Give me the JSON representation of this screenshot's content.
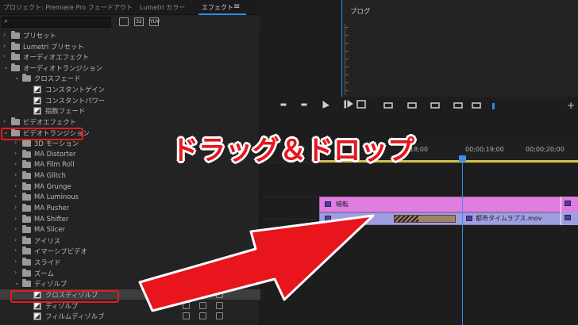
{
  "tabs": {
    "project": "プロジェクト: Premiere Pro フェードアウト",
    "lumetri": "Lumetri カラー",
    "effects": "エフェクト",
    "menu_icon": "hamburger-icon"
  },
  "search": {
    "placeholder": "",
    "icon": "search-icon"
  },
  "filter_buttons": [
    "accelerated-effects-icon",
    "32bit-icon",
    "yuv-icon"
  ],
  "tree": [
    {
      "label": "プリセット",
      "indent": 0,
      "expanded": false,
      "type": "folder-star"
    },
    {
      "label": "Lumetri プリセット",
      "indent": 0,
      "expanded": false,
      "type": "folder-star"
    },
    {
      "label": "オーディオエフェクト",
      "indent": 0,
      "expanded": false,
      "type": "folder"
    },
    {
      "label": "オーディオトランジション",
      "indent": 0,
      "expanded": true,
      "type": "folder"
    },
    {
      "label": "クロスフェード",
      "indent": 1,
      "expanded": true,
      "type": "folder"
    },
    {
      "label": "コンスタントゲイン",
      "indent": 2,
      "type": "effect"
    },
    {
      "label": "コンスタントパワー",
      "indent": 2,
      "type": "effect"
    },
    {
      "label": "指数フェード",
      "indent": 2,
      "type": "effect"
    },
    {
      "label": "ビデオエフェクト",
      "indent": 0,
      "expanded": false,
      "type": "folder"
    },
    {
      "label": "ビデオトランジション",
      "indent": 0,
      "expanded": true,
      "type": "folder",
      "highlight": true
    },
    {
      "label": "3D モーション",
      "indent": 1,
      "expanded": false,
      "type": "folder"
    },
    {
      "label": "MA Distorter",
      "indent": 1,
      "expanded": false,
      "type": "folder"
    },
    {
      "label": "MA Film Roll",
      "indent": 1,
      "expanded": false,
      "type": "folder"
    },
    {
      "label": "MA Glitch",
      "indent": 1,
      "expanded": false,
      "type": "folder"
    },
    {
      "label": "MA Grunge",
      "indent": 1,
      "expanded": false,
      "type": "folder"
    },
    {
      "label": "MA Luminous",
      "indent": 1,
      "expanded": false,
      "type": "folder"
    },
    {
      "label": "MA Pusher",
      "indent": 1,
      "expanded": false,
      "type": "folder"
    },
    {
      "label": "MA Shifter",
      "indent": 1,
      "expanded": false,
      "type": "folder"
    },
    {
      "label": "MA Slicer",
      "indent": 1,
      "expanded": false,
      "type": "folder"
    },
    {
      "label": "アイリス",
      "indent": 1,
      "expanded": false,
      "type": "folder"
    },
    {
      "label": "イマーシブビデオ",
      "indent": 1,
      "expanded": false,
      "type": "folder"
    },
    {
      "label": "スライド",
      "indent": 1,
      "expanded": false,
      "type": "folder"
    },
    {
      "label": "ズーム",
      "indent": 1,
      "expanded": false,
      "type": "folder"
    },
    {
      "label": "ディゾルブ",
      "indent": 1,
      "expanded": true,
      "type": "folder"
    },
    {
      "label": "クロスディゾルブ",
      "indent": 2,
      "type": "effect",
      "selected": true,
      "highlight": true,
      "badges": true
    },
    {
      "label": "ディゾルブ",
      "indent": 2,
      "type": "effect",
      "badges": true
    },
    {
      "label": "フィルムディゾルブ",
      "indent": 2,
      "type": "effect",
      "badges": true
    }
  ],
  "program": {
    "label": "プログ"
  },
  "transport_icons": [
    "mark-in-icon",
    "mark-out-icon",
    "go-to-in-icon",
    "step-back-icon",
    "play-icon",
    "step-forward-icon",
    "go-to-out-icon",
    "lift-icon",
    "extract-icon",
    "export-frame-icon",
    "add-button-icon"
  ],
  "timeline": {
    "timecodes": [
      "18;00",
      "00;00;19;00",
      "00;00;20;00"
    ],
    "transition_clip": "暗転",
    "video_clip": "都市タイムラプス.mov"
  },
  "overlay": {
    "text": "ドラッグ＆ドロップ",
    "color": "#e8151c",
    "arrow_color": "#e8151c"
  },
  "colors": {
    "accent": "#2d8ceb",
    "transition_clip": "#e07ee0",
    "video_clip": "#9f9fe0",
    "highlight": "#e8191c",
    "workarea": "#d4c14a"
  }
}
